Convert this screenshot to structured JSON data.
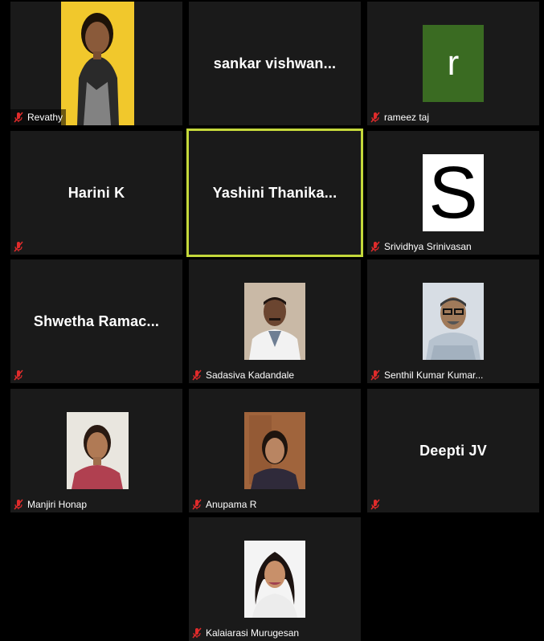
{
  "participants": [
    {
      "name": "Revathy"
    },
    {
      "name": "sankar  vishwan..."
    },
    {
      "name": "rameez taj",
      "avatar_letter": "r",
      "avatar_color": "#3a6b22"
    },
    {
      "name": "Harini K"
    },
    {
      "name": "Yashini  Thanika..."
    },
    {
      "name": "Srividhya Srinivasan",
      "avatar_letter": "S",
      "avatar_color": "#ffffff"
    },
    {
      "name": "Shwetha  Ramac..."
    },
    {
      "name": "Sadasiva Kadandale"
    },
    {
      "name": "Senthil Kumar Kumar..."
    },
    {
      "name": "Manjiri Honap"
    },
    {
      "name": "Anupama R"
    },
    {
      "name": "Deepti JV"
    },
    {
      "name": "Kalaiarasi Murugesan"
    }
  ],
  "colors": {
    "tile_bg": "#1a1a1a",
    "active_speaker_border": "#c4d83a",
    "muted_icon": "#e02b2b"
  },
  "icons": {
    "muted": "muted-mic-icon"
  }
}
